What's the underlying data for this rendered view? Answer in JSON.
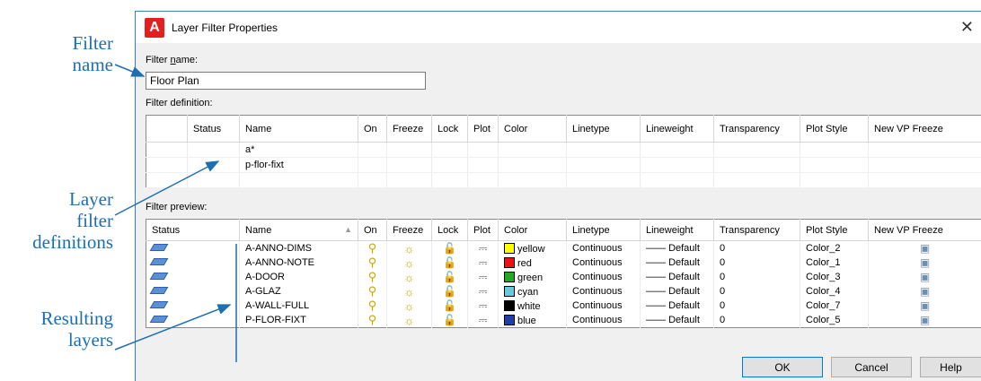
{
  "callouts": {
    "filter_name": [
      "Filter",
      "name"
    ],
    "definitions": [
      "Layer",
      "filter",
      "definitions"
    ],
    "resulting": [
      "Resulting",
      "layers"
    ]
  },
  "dialog": {
    "title": "Layer Filter Properties",
    "app_icon": "A",
    "filter_name_label_pre": "Filter ",
    "filter_name_label_u": "n",
    "filter_name_label_post": "ame:",
    "filter_name_value": "Floor Plan",
    "filter_definition_label": "Filter definition:",
    "filter_preview_label": "Filter preview:"
  },
  "definition_table": {
    "columns": [
      "",
      "Status",
      "Name",
      "On",
      "Freeze",
      "Lock",
      "Plot",
      "Color",
      "Linetype",
      "Lineweight",
      "Transparency",
      "Plot Style",
      "New VP Freeze"
    ],
    "rows": [
      {
        "name": "a*"
      },
      {
        "name": "p-flor-fixt"
      },
      {
        "name": ""
      }
    ]
  },
  "preview_table": {
    "columns": [
      "Status",
      "Name",
      "On",
      "Freeze",
      "Lock",
      "Plot",
      "Color",
      "Linetype",
      "Lineweight",
      "Transparency",
      "Plot Style",
      "New VP Freeze"
    ],
    "rows": [
      {
        "name": "A-ANNO-DIMS",
        "color_hex": "#ffff00",
        "color": "yellow",
        "linetype": "Continuous",
        "lineweight": "Default",
        "transparency": "0",
        "plot_style": "Color_2"
      },
      {
        "name": "A-ANNO-NOTE",
        "color_hex": "#ee1111",
        "color": "red",
        "linetype": "Continuous",
        "lineweight": "Default",
        "transparency": "0",
        "plot_style": "Color_1"
      },
      {
        "name": "A-DOOR",
        "color_hex": "#22aa22",
        "color": "green",
        "linetype": "Continuous",
        "lineweight": "Default",
        "transparency": "0",
        "plot_style": "Color_3"
      },
      {
        "name": "A-GLAZ",
        "color_hex": "#66ccdd",
        "color": "cyan",
        "linetype": "Continuous",
        "lineweight": "Default",
        "transparency": "0",
        "plot_style": "Color_4"
      },
      {
        "name": "A-WALL-FULL",
        "color_hex": "#000000",
        "color": "white",
        "linetype": "Continuous",
        "lineweight": "Default",
        "transparency": "0",
        "plot_style": "Color_7"
      },
      {
        "name": "P-FLOR-FIXT",
        "color_hex": "#1f3ea8",
        "color": "blue",
        "linetype": "Continuous",
        "lineweight": "Default",
        "transparency": "0",
        "plot_style": "Color_5"
      }
    ]
  },
  "icons": {
    "on": "lightbulb-icon",
    "freeze": "sun-icon",
    "lock": "unlocked-padlock-icon",
    "plot": "printer-icon",
    "vp": "viewport-freeze-icon",
    "status": "layer-status-icon"
  },
  "buttons": {
    "ok": "OK",
    "cancel": "Cancel",
    "help": "Help"
  }
}
